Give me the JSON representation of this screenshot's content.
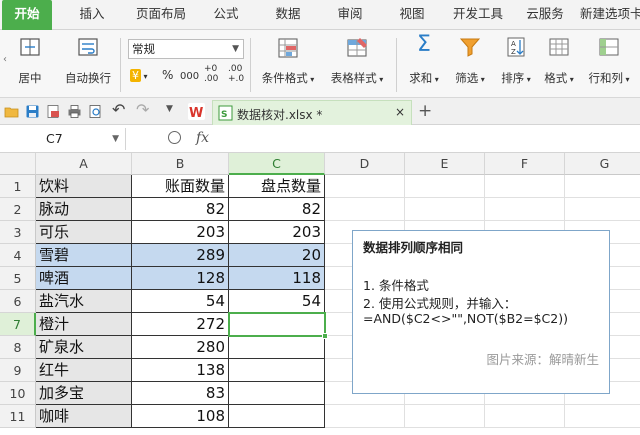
{
  "menu": {
    "tabs": [
      "开始",
      "插入",
      "页面布局",
      "公式",
      "数据",
      "审阅",
      "视图",
      "开发工具",
      "云服务",
      "新建选项卡"
    ],
    "active": 0
  },
  "ribbon": {
    "merge_label": "居中",
    "wrap_label": "自动换行",
    "number_format": "常规",
    "cond_format_label": "条件格式",
    "table_style_label": "表格样式",
    "sum_label": "求和",
    "filter_label": "筛选",
    "sort_label": "排序",
    "format_label": "格式",
    "rowcol_label": "行和列",
    "currency_sym": "¥",
    "percent_sym": "%",
    "comma_sym": "000",
    "inc_decimal": "+0 .00",
    "dec_decimal": ".00 +.0"
  },
  "doc": {
    "filename": "数据核对.xlsx *",
    "new_tab": "+"
  },
  "formula_bar": {
    "name_box": "C7",
    "fx": "fx",
    "formula": ""
  },
  "sheet": {
    "columns": [
      "A",
      "B",
      "C",
      "D",
      "E",
      "F",
      "G"
    ],
    "rows": [
      "1",
      "2",
      "3",
      "4",
      "5",
      "6",
      "7",
      "8",
      "9",
      "10",
      "11"
    ],
    "selected_column": "C",
    "selected_row": "7",
    "header": {
      "a": "饮料",
      "b": "账面数量",
      "c": "盘点数量"
    },
    "data": [
      {
        "a": "脉动",
        "b": "82",
        "c": "82"
      },
      {
        "a": "可乐",
        "b": "203",
        "c": "203"
      },
      {
        "a": "雪碧",
        "b": "289",
        "c": "20"
      },
      {
        "a": "啤酒",
        "b": "128",
        "c": "118"
      },
      {
        "a": "盐汽水",
        "b": "54",
        "c": "54"
      },
      {
        "a": "橙汁",
        "b": "272",
        "c": ""
      },
      {
        "a": "矿泉水",
        "b": "280",
        "c": ""
      },
      {
        "a": "红牛",
        "b": "138",
        "c": ""
      },
      {
        "a": "加多宝",
        "b": "83",
        "c": ""
      },
      {
        "a": "咖啡",
        "b": "108",
        "c": ""
      }
    ],
    "highlighted_rows": [
      4,
      5
    ],
    "colors": {
      "highlight": "#c5d9ef",
      "accent": "#4cae4c"
    }
  },
  "note": {
    "title": "数据排列顺序相同",
    "line1": "1. 条件格式",
    "line2": "2. 使用公式规则，并输入：",
    "line3": "=AND($C2<>\"\",NOT($B2=$C2))",
    "source": "图片来源：解晴新生"
  }
}
